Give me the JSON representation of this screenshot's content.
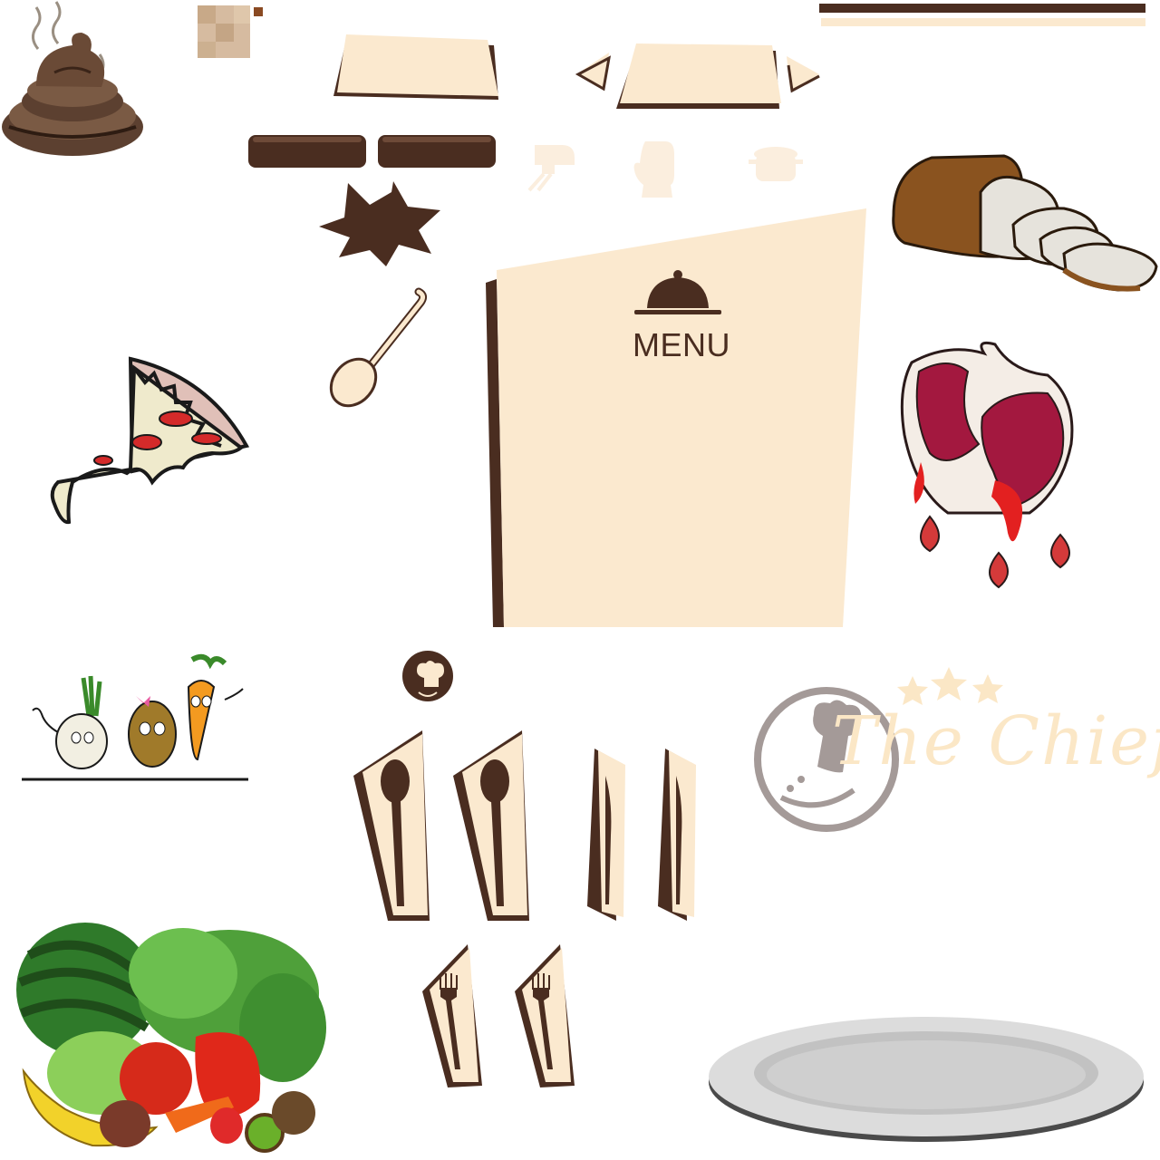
{
  "menu_panel": {
    "title": "MENU"
  },
  "logo": {
    "brand_text": "The Chief",
    "star_count": 3
  },
  "sprites": [
    "poop-icon",
    "texture-swatch",
    "divider-bars",
    "menu-tab",
    "menu-tab-arrows",
    "dark-button",
    "dark-button",
    "mixer-icon",
    "oven-mitt-icon",
    "pot-icon",
    "starburst-shape",
    "bread-icon",
    "spoon-icon",
    "menu-panel",
    "pizza-slice-icon",
    "steak-icon",
    "veggie-characters-icon",
    "chef-hat-badge-icon",
    "the-chief-logo",
    "spoon-card",
    "spoon-card",
    "knife-card",
    "knife-card",
    "fork-card",
    "fork-card",
    "fruit-vegetable-pile-icon",
    "plate-icon"
  ],
  "colors": {
    "cream": "#fbe9cf",
    "dark_brown": "#4a2d20",
    "bread_brown": "#8a531f",
    "steak_red": "#a3183f",
    "logo_gray": "#a49a98",
    "logo_cream": "#fbe7c6",
    "plate_gray": "#c8c8c8"
  }
}
